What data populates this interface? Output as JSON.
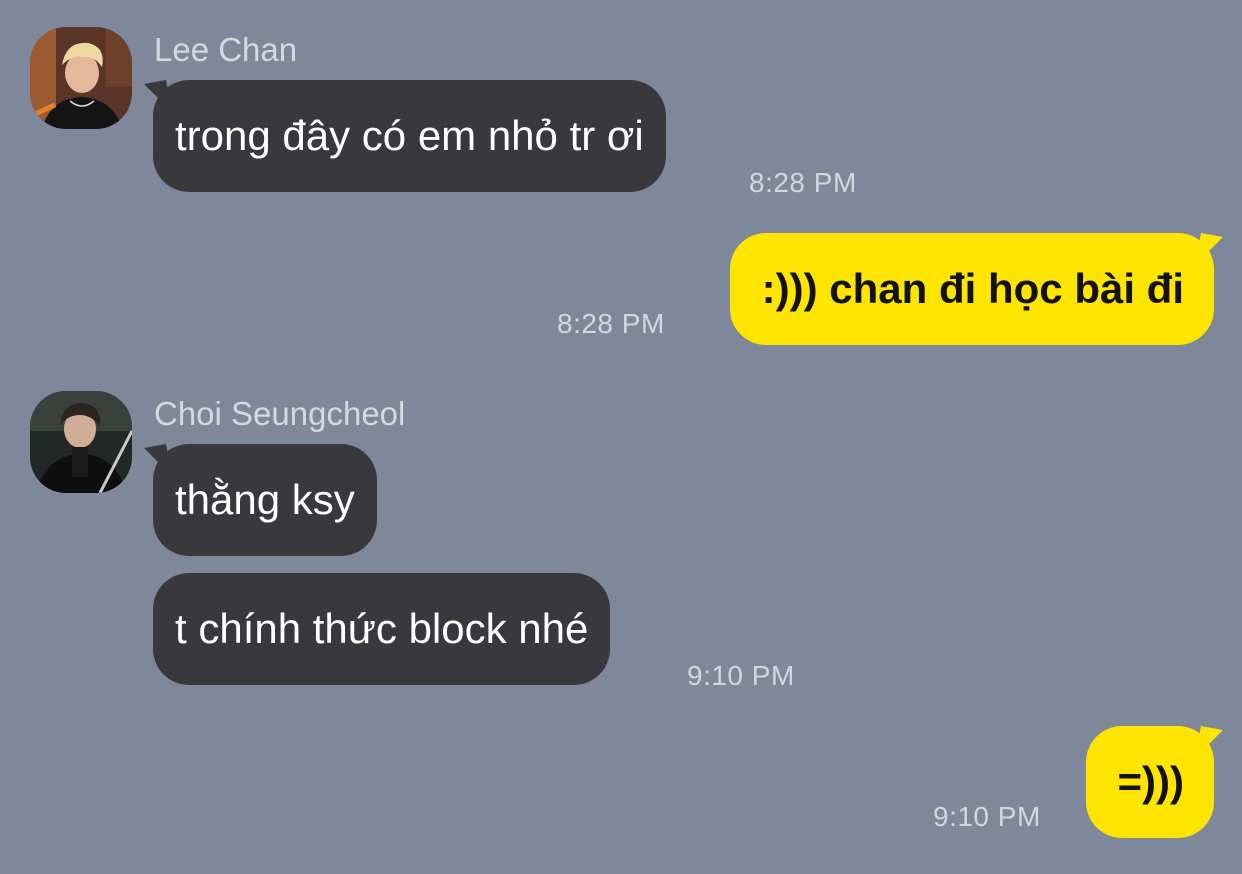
{
  "chat": {
    "colors": {
      "background": "#7f889b",
      "incoming_bubble": "#39393d",
      "outgoing_bubble": "#fee500",
      "sender_name": "#d4d8e0",
      "timestamp": "#d2d6de"
    },
    "messages": [
      {
        "sender": "Lee Chan",
        "avatar": "avatar-lee-chan",
        "direction": "incoming",
        "text": "trong đây có em nhỏ tr ơi",
        "time": "8:28 PM"
      },
      {
        "direction": "outgoing",
        "text": ":))) chan đi học bài đi",
        "time": "8:28 PM"
      },
      {
        "sender": "Choi Seungcheol",
        "avatar": "avatar-choi-seungcheol",
        "direction": "incoming",
        "text": "thằng ksy"
      },
      {
        "direction": "incoming",
        "text": "t chính thức block nhé",
        "time": "9:10 PM"
      },
      {
        "direction": "outgoing",
        "text": "=)))",
        "time": "9:10 PM"
      }
    ]
  }
}
